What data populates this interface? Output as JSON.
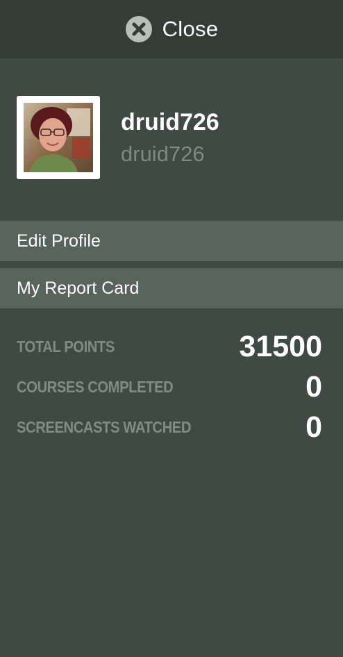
{
  "header": {
    "close_label": "Close",
    "close_icon": "close-circle-icon",
    "icon_color": "#b8c0b9"
  },
  "profile": {
    "display_name": "druid726",
    "username": "druid726",
    "avatar_alt": "avatar"
  },
  "menu": {
    "items": [
      {
        "label": "Edit Profile"
      },
      {
        "label": "My Report Card"
      }
    ]
  },
  "stats": [
    {
      "label": "TOTAL POINTS",
      "value": "31500"
    },
    {
      "label": "COURSES COMPLETED",
      "value": "0"
    },
    {
      "label": "SCREENCASTS WATCHED",
      "value": "0"
    }
  ],
  "colors": {
    "panel_bg": "#3f4a44",
    "topbar_bg": "#333c37",
    "menu_item_bg": "#57645d",
    "muted_text": "#7f8b84"
  }
}
